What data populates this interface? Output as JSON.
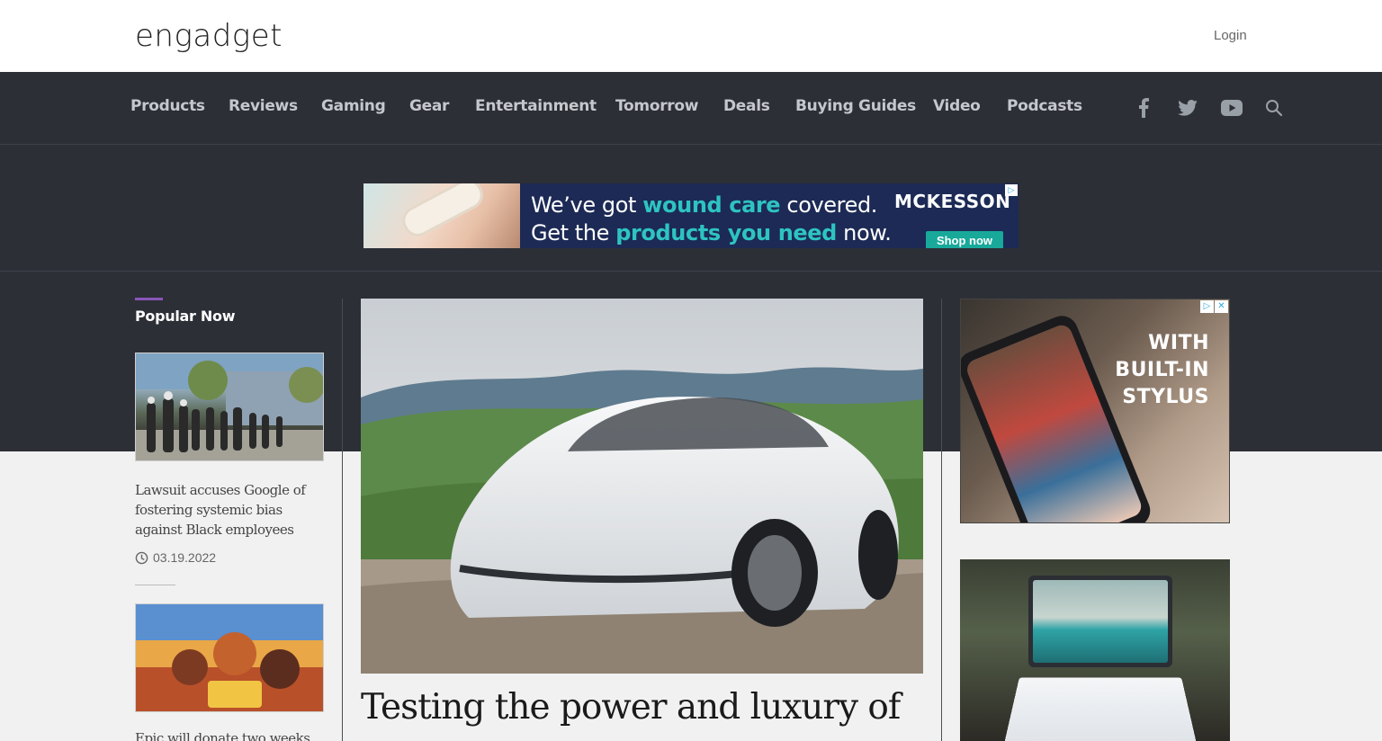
{
  "header": {
    "logo": "engadget",
    "login_label": "Login"
  },
  "nav": {
    "items": [
      {
        "label": "Products"
      },
      {
        "label": "Reviews"
      },
      {
        "label": "Gaming"
      },
      {
        "label": "Gear"
      },
      {
        "label": "Entertainment"
      },
      {
        "label": "Tomorrow"
      },
      {
        "label": "Deals"
      },
      {
        "label": "Buying Guides"
      },
      {
        "label": "Video"
      },
      {
        "label": "Podcasts"
      }
    ],
    "social_icons": [
      "facebook-icon",
      "twitter-icon",
      "youtube-icon",
      "search-icon"
    ]
  },
  "banner_ad": {
    "line1_a": "We’ve got ",
    "line1_b": "wound care",
    "line1_c": " covered.",
    "line2_a": "Get the ",
    "line2_b": "products you need",
    "line2_c": " now.",
    "brand": "MCKESSON",
    "cta": "Shop now"
  },
  "popular": {
    "heading": "Popular Now",
    "stories": [
      {
        "title": "Lawsuit accuses Google of fostering systemic bias against Black employees",
        "date": "03.19.2022"
      },
      {
        "title": "Epic will donate two weeks of"
      }
    ]
  },
  "hero": {
    "title": "Testing the power and luxury of"
  },
  "side_ad": {
    "line1": "WITH",
    "line2": "BUILT-IN",
    "line3": "STYLUS"
  },
  "colors": {
    "dark_band": "#2c2f36",
    "accent_purple": "#8a56b8",
    "banner_teal": "#2ec4c0",
    "banner_navy": "#1c2a55"
  }
}
